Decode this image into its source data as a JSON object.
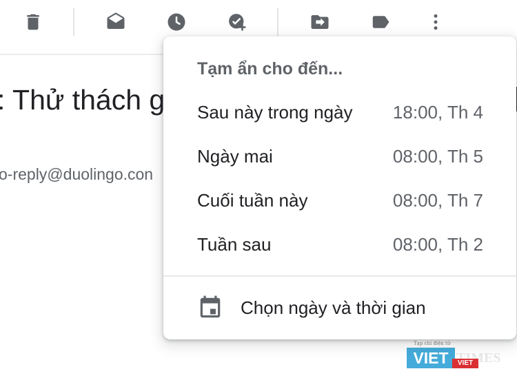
{
  "toolbar": {
    "icons": [
      "delete-icon",
      "mark-as-read-icon",
      "snooze-icon",
      "add-to-tasks-icon",
      "move-to-icon",
      "label-icon",
      "more-vert-icon"
    ]
  },
  "email": {
    "subject_visible": ": Thử thách g",
    "sender_visible": "o-reply@duolingo.con"
  },
  "snooze_menu": {
    "title": "Tạm ẩn cho đến...",
    "options": [
      {
        "label": "Sau này trong ngày",
        "time": "18:00, Th 4"
      },
      {
        "label": "Ngày mai",
        "time": "08:00, Th 5"
      },
      {
        "label": "Cuối tuần này",
        "time": "08:00, Th 7"
      },
      {
        "label": "Tuần sau",
        "time": "08:00, Th 2"
      }
    ],
    "pick_date_label": "Chọn ngày và thời gian"
  },
  "watermark": {
    "small": "Tạp chí điện tử",
    "viet": "VIET",
    "times": "TIMES",
    "sub": "VIET"
  },
  "colors": {
    "icon": "#5f6368",
    "text": "#202124",
    "secondary": "#5f6368",
    "watermark_blue": "#3aa7d9",
    "watermark_red": "#d9252a"
  }
}
